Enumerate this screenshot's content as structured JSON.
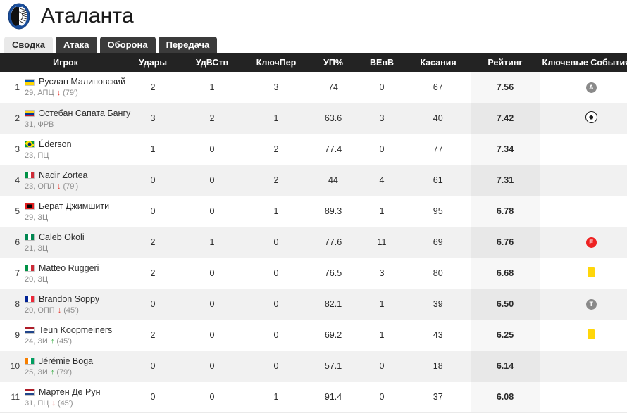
{
  "header": {
    "team_name": "Аталанта",
    "logo_name": "atalanta-logo"
  },
  "tabs": [
    {
      "label": "Сводка",
      "active": true
    },
    {
      "label": "Атака",
      "active": false
    },
    {
      "label": "Оборона",
      "active": false
    },
    {
      "label": "Передача",
      "active": false
    }
  ],
  "table": {
    "columns": [
      "Игрок",
      "Удары",
      "УдВСтв",
      "КлючПер",
      "УП%",
      "ВЕвВ",
      "Касания",
      "Рейтинг",
      "Ключевые События"
    ],
    "rows": [
      {
        "rank": "1",
        "name": "Руслан Малиновский",
        "meta": "29, АПЦ",
        "flag": "ua",
        "sub": "off",
        "sub_min": "(79')",
        "shots": "2",
        "sot": "1",
        "kp": "3",
        "pa": "74",
        "ad": "0",
        "touches": "67",
        "rating": "7.56",
        "events": [
          "assist"
        ]
      },
      {
        "rank": "2",
        "name": "Эстебан Сапата Бангу",
        "meta": "31, ФРВ",
        "flag": "co",
        "sub": "",
        "sub_min": "",
        "shots": "3",
        "sot": "2",
        "kp": "1",
        "pa": "63.6",
        "ad": "3",
        "touches": "40",
        "rating": "7.42",
        "events": [
          "goal"
        ]
      },
      {
        "rank": "3",
        "name": "Éderson",
        "meta": "23, ПЦ",
        "flag": "br",
        "sub": "",
        "sub_min": "",
        "shots": "1",
        "sot": "0",
        "kp": "2",
        "pa": "77.4",
        "ad": "0",
        "touches": "77",
        "rating": "7.34",
        "events": []
      },
      {
        "rank": "4",
        "name": "Nadir Zortea",
        "meta": "23, ОПЛ",
        "flag": "it",
        "sub": "off",
        "sub_min": "(79')",
        "shots": "0",
        "sot": "0",
        "kp": "2",
        "pa": "44",
        "ad": "4",
        "touches": "61",
        "rating": "7.31",
        "events": []
      },
      {
        "rank": "5",
        "name": "Берат Джимшити",
        "meta": "29, ЗЦ",
        "flag": "al",
        "sub": "",
        "sub_min": "",
        "shots": "0",
        "sot": "0",
        "kp": "1",
        "pa": "89.3",
        "ad": "1",
        "touches": "95",
        "rating": "6.78",
        "events": []
      },
      {
        "rank": "6",
        "name": "Caleb Okoli",
        "meta": "21, ЗЦ",
        "flag": "ng",
        "sub": "",
        "sub_min": "",
        "shots": "2",
        "sot": "1",
        "kp": "0",
        "pa": "77.6",
        "ad": "11",
        "touches": "69",
        "rating": "6.76",
        "events": [
          "error"
        ]
      },
      {
        "rank": "7",
        "name": "Matteo Ruggeri",
        "meta": "20, ЗЦ",
        "flag": "it",
        "sub": "",
        "sub_min": "",
        "shots": "2",
        "sot": "0",
        "kp": "0",
        "pa": "76.5",
        "ad": "3",
        "touches": "80",
        "rating": "6.68",
        "events": [
          "yellow"
        ]
      },
      {
        "rank": "8",
        "name": "Brandon Soppy",
        "meta": "20, ОПП",
        "flag": "fr",
        "sub": "off",
        "sub_min": "(45')",
        "shots": "0",
        "sot": "0",
        "kp": "0",
        "pa": "82.1",
        "ad": "1",
        "touches": "39",
        "rating": "6.50",
        "events": [
          "tackle"
        ]
      },
      {
        "rank": "9",
        "name": "Teun Koopmeiners",
        "meta": "24, ЗИ",
        "flag": "nl",
        "sub": "on",
        "sub_min": "(45')",
        "shots": "2",
        "sot": "0",
        "kp": "0",
        "pa": "69.2",
        "ad": "1",
        "touches": "43",
        "rating": "6.25",
        "events": [
          "yellow"
        ]
      },
      {
        "rank": "10",
        "name": "Jérémie Boga",
        "meta": "25, ЗИ",
        "flag": "ci",
        "sub": "on",
        "sub_min": "(79')",
        "shots": "0",
        "sot": "0",
        "kp": "0",
        "pa": "57.1",
        "ad": "0",
        "touches": "18",
        "rating": "6.14",
        "events": []
      },
      {
        "rank": "11",
        "name": "Мартен Де Рун",
        "meta": "31, ПЦ",
        "flag": "nl",
        "sub": "off",
        "sub_min": "(45')",
        "shots": "0",
        "sot": "0",
        "kp": "1",
        "pa": "91.4",
        "ad": "0",
        "touches": "37",
        "rating": "6.08",
        "events": []
      }
    ]
  },
  "colors": {
    "header_bg": "#232323",
    "rating_accent": "#e8533a",
    "tab_inactive_bg": "#3b3b3b",
    "tab_active_bg": "#e9e9e9",
    "yellow_card": "#ffd60a",
    "sub_off": "#e53a30",
    "sub_on": "#2faa3c"
  },
  "event_labels": {
    "assist": "A",
    "error": "E",
    "tackle": "T"
  }
}
